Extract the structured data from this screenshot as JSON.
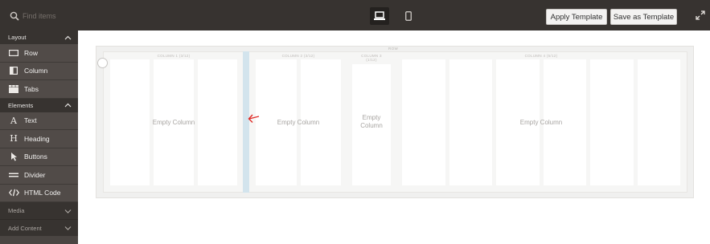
{
  "toolbar": {
    "search_placeholder": "Find items",
    "apply_template_label": "Apply Template",
    "save_as_template_label": "Save as Template",
    "devices": [
      "desktop-icon",
      "mobile-icon"
    ]
  },
  "sidebar": {
    "sections": [
      {
        "label": "Layout",
        "state": "expanded",
        "items": [
          {
            "label": "Row",
            "icon": "row-icon"
          },
          {
            "label": "Column",
            "icon": "column-icon"
          },
          {
            "label": "Tabs",
            "icon": "tabs-icon"
          }
        ]
      },
      {
        "label": "Elements",
        "state": "expanded",
        "items": [
          {
            "label": "Text",
            "icon": "text-icon"
          },
          {
            "label": "Heading",
            "icon": "heading-icon"
          },
          {
            "label": "Buttons",
            "icon": "cursor-icon"
          },
          {
            "label": "Divider",
            "icon": "divider-icon"
          },
          {
            "label": "HTML Code",
            "icon": "code-icon"
          }
        ]
      },
      {
        "label": "Media",
        "state": "collapsed",
        "items": []
      },
      {
        "label": "Add Content",
        "state": "collapsed",
        "items": []
      }
    ]
  },
  "stage": {
    "row_label": "ROW",
    "columns": [
      {
        "header": "COLUMN 1 (3/12)",
        "empty_label": "Empty Column"
      },
      {
        "header": "COLUMN 2 (3/12)",
        "empty_label": "Empty Column"
      },
      {
        "header": "COLUMN 3 (1/12)",
        "empty_label": "Empty Column"
      },
      {
        "header": "COLUMN 4 (5/12)",
        "empty_label": "Empty Column"
      }
    ]
  },
  "colors": {
    "topbar_bg": "#373330",
    "sidebar_bg": "#4a4542",
    "stage_bg": "#f0f0ef",
    "divider_highlight": "#d3e4ed",
    "arrow": "#e02b27"
  }
}
